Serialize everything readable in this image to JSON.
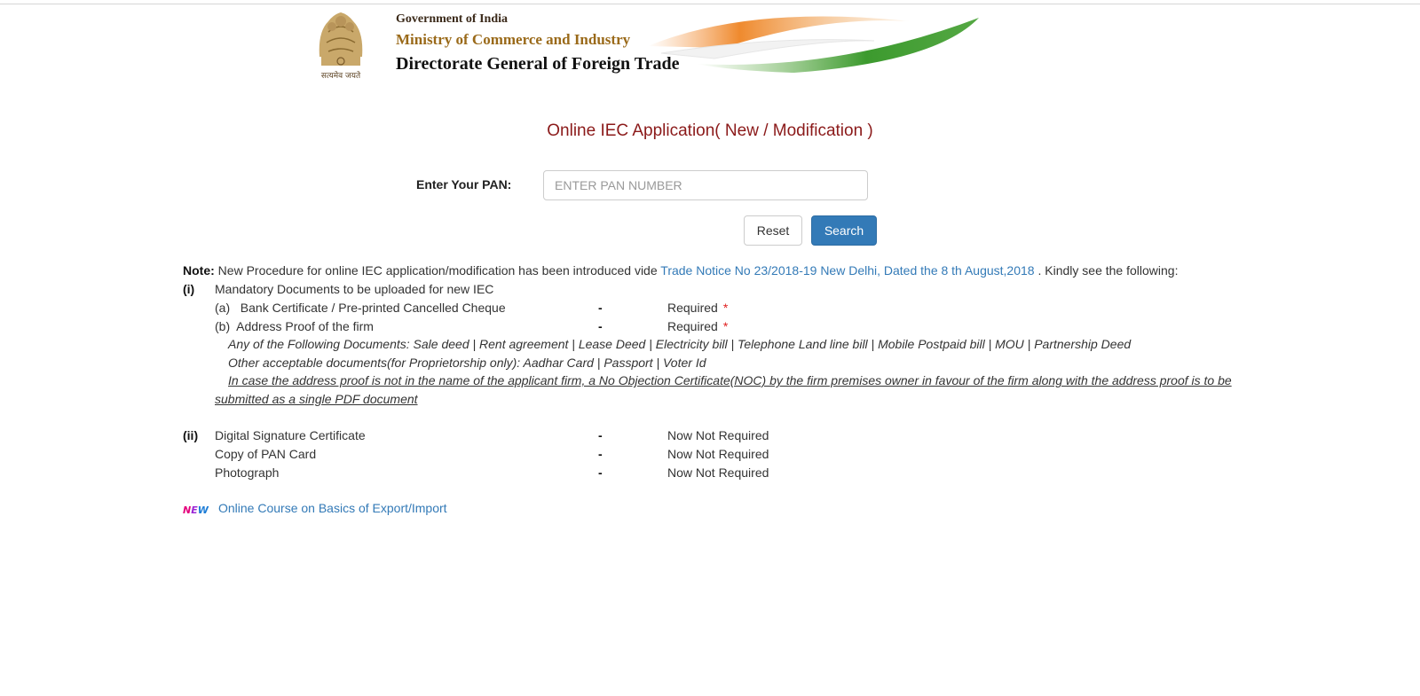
{
  "header": {
    "government": "Government of India",
    "ministry": "Ministry of Commerce and Industry",
    "directorate": "Directorate General of Foreign Trade",
    "emblem_motto": "सत्यमेव जयते"
  },
  "title": "Online IEC Application( New / Modification )",
  "pan_form": {
    "label": "Enter Your PAN:",
    "placeholder": "ENTER PAN NUMBER",
    "value": "",
    "reset_label": "Reset",
    "search_label": "Search"
  },
  "note": {
    "label": "Note:",
    "text_before": "New Procedure for online IEC application/modification has been introduced vide",
    "link_text": "Trade Notice No 23/2018-19 New Delhi, Dated the 8 th August,2018",
    "text_after": ". Kindly see the following:"
  },
  "section_i": {
    "marker": "(i)",
    "heading": "Mandatory Documents to be uploaded for new IEC",
    "items": [
      {
        "label": "(a)   Bank Certificate / Pre-printed Cancelled Cheque",
        "dash": "-",
        "status": "Required",
        "star": "*"
      },
      {
        "label": "(b)  Address Proof of the firm",
        "dash": "-",
        "status": "Required",
        "star": "*"
      }
    ],
    "acceptable": "Any of the Following Documents: Sale deed | Rent agreement | Lease Deed | Electricity bill | Telephone Land line bill | Mobile Postpaid bill | MOU | Partnership Deed",
    "other_acceptable": "Other acceptable documents(for Proprietorship only): Aadhar Card | Passport | Voter Id",
    "noc_note": "In case the address proof is not in the name of the applicant firm, a No Objection Certificate(NOC) by the firm premises owner in favour of the firm along with the address proof is to be submitted as a single PDF document"
  },
  "section_ii": {
    "marker": "(ii)",
    "items": [
      {
        "label": "Digital Signature Certificate",
        "dash": "-",
        "status": "Now Not Required"
      },
      {
        "label": "Copy of PAN Card",
        "dash": "-",
        "status": "Now Not Required"
      },
      {
        "label": "Photograph",
        "dash": "-",
        "status": "Now Not Required"
      }
    ]
  },
  "course": {
    "badge": [
      "N",
      "E",
      "W"
    ],
    "link_text": "Online Course on Basics of Export/Import"
  },
  "colors": {
    "title": "#8b1a1a",
    "link": "#337ab7",
    "search_button": "#337ab7",
    "required_star": "#e02020"
  }
}
